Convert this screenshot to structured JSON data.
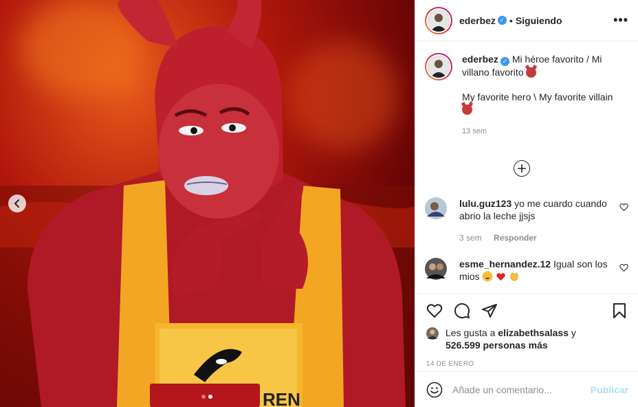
{
  "post": {
    "author": "ederbez",
    "follow_separator": "•",
    "follow_status": "Siguiendo",
    "caption": {
      "line1": "Mi héroe favorito / Mi villano favorito",
      "line2": "My favorite hero \\ My favorite villain",
      "time": "13 sem"
    },
    "comments": [
      {
        "user": "lulu.guz123",
        "text": "yo me cuardo cuando abrio la leche jjsjs",
        "time": "3 sem",
        "reply_label": "Responder"
      },
      {
        "user": "esme_hernandez.12",
        "text": "Igual son los mios",
        "time": "",
        "reply_label": ""
      }
    ],
    "likes": {
      "prefix": "Les gusta a",
      "user": "elizabethsalass",
      "conj": "y",
      "count": "526.599 personas más"
    },
    "date": "14 DE ENERO",
    "comment_input": {
      "placeholder": "Añade un comentario...",
      "value": ""
    },
    "publish_label": "Publicar",
    "carousel": {
      "total": 2,
      "current": 2
    },
    "photo_label": "REN"
  },
  "icons": {
    "more": "more-options-icon",
    "verified": "verified-badge-icon",
    "prev": "chevron-left-icon",
    "load": "plus-circle-icon",
    "like": "heart-icon",
    "comment": "comment-bubble-icon",
    "share": "paper-plane-icon",
    "save": "bookmark-icon",
    "emoji": "smiley-icon"
  },
  "colors": {
    "verified": "#3897f0",
    "publish_disabled": "#b2dffc",
    "muted_text": "#8e8e8e",
    "story_ring_start": "#f09433",
    "story_ring_end": "#bc1888"
  }
}
